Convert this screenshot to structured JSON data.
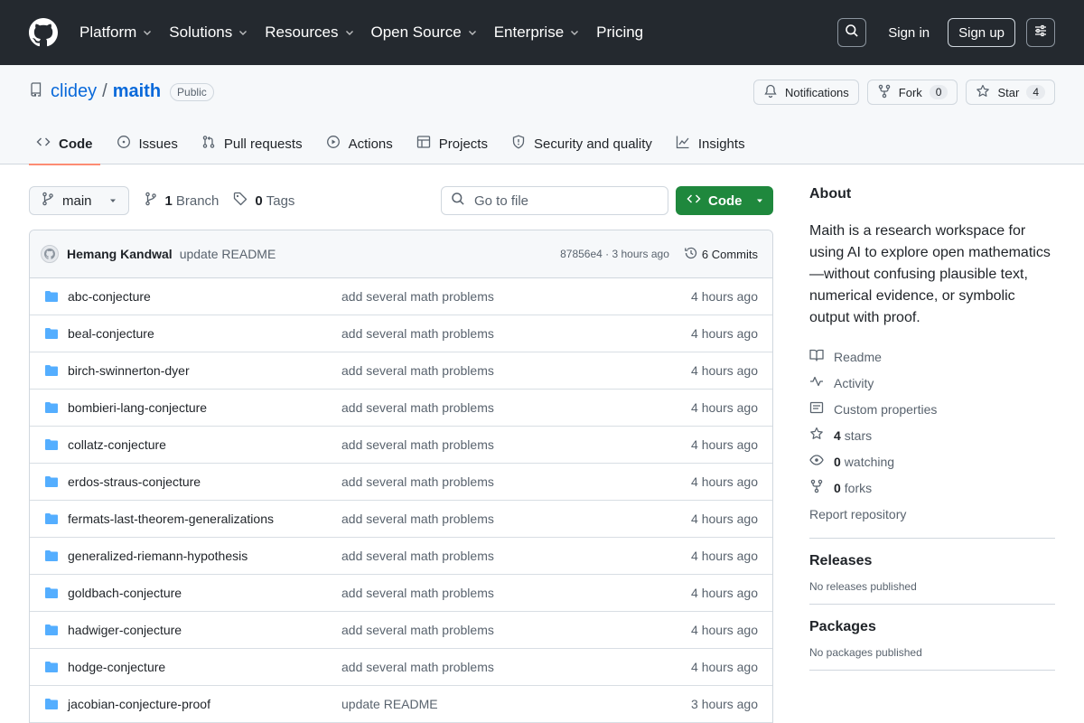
{
  "header": {
    "nav": [
      {
        "label": "Platform",
        "dropdown": true
      },
      {
        "label": "Solutions",
        "dropdown": true
      },
      {
        "label": "Resources",
        "dropdown": true
      },
      {
        "label": "Open Source",
        "dropdown": true
      },
      {
        "label": "Enterprise",
        "dropdown": true
      },
      {
        "label": "Pricing",
        "dropdown": false
      }
    ],
    "signin": "Sign in",
    "signup": "Sign up"
  },
  "repo": {
    "owner": "clidey",
    "slash": "/",
    "name": "maith",
    "visibility": "Public",
    "actions": {
      "notifications": "Notifications",
      "fork": "Fork",
      "fork_count": "0",
      "star": "Star",
      "star_count": "4"
    },
    "tabs": [
      {
        "label": "Code",
        "icon": "code-icon"
      },
      {
        "label": "Issues",
        "icon": "issue-icon"
      },
      {
        "label": "Pull requests",
        "icon": "pull-request-icon"
      },
      {
        "label": "Actions",
        "icon": "play-icon"
      },
      {
        "label": "Projects",
        "icon": "table-icon"
      },
      {
        "label": "Security and quality",
        "icon": "shield-icon"
      },
      {
        "label": "Insights",
        "icon": "graph-icon"
      }
    ]
  },
  "controls": {
    "branch": "main",
    "branch_count": "1",
    "branch_label": "Branch",
    "tag_count": "0",
    "tag_label": "Tags",
    "goto_placeholder": "Go to file",
    "code_button": "Code"
  },
  "commit": {
    "author": "Hemang Kandwal",
    "message": "update README",
    "hash_age": "87856e4 · 3 hours ago",
    "count": "6 Commits"
  },
  "files": [
    {
      "name": "abc-conjecture",
      "message": "add several math problems",
      "age": "4 hours ago"
    },
    {
      "name": "beal-conjecture",
      "message": "add several math problems",
      "age": "4 hours ago"
    },
    {
      "name": "birch-swinnerton-dyer",
      "message": "add several math problems",
      "age": "4 hours ago"
    },
    {
      "name": "bombieri-lang-conjecture",
      "message": "add several math problems",
      "age": "4 hours ago"
    },
    {
      "name": "collatz-conjecture",
      "message": "add several math problems",
      "age": "4 hours ago"
    },
    {
      "name": "erdos-straus-conjecture",
      "message": "add several math problems",
      "age": "4 hours ago"
    },
    {
      "name": "fermats-last-theorem-generalizations",
      "message": "add several math problems",
      "age": "4 hours ago"
    },
    {
      "name": "generalized-riemann-hypothesis",
      "message": "add several math problems",
      "age": "4 hours ago"
    },
    {
      "name": "goldbach-conjecture",
      "message": "add several math problems",
      "age": "4 hours ago"
    },
    {
      "name": "hadwiger-conjecture",
      "message": "add several math problems",
      "age": "4 hours ago"
    },
    {
      "name": "hodge-conjecture",
      "message": "add several math problems",
      "age": "4 hours ago"
    },
    {
      "name": "jacobian-conjecture-proof",
      "message": "update README",
      "age": "3 hours ago"
    }
  ],
  "sidebar": {
    "about_title": "About",
    "about_text": "Maith is a research workspace for using AI to explore open mathematics—without confusing plausible text, numerical evidence, or symbolic output with proof.",
    "links": {
      "readme": "Readme",
      "activity": "Activity",
      "custom": "Custom properties",
      "stars_count": "4",
      "stars_label": "stars",
      "watching_count": "0",
      "watching_label": "watching",
      "forks_count": "0",
      "forks_label": "forks",
      "report": "Report repository"
    },
    "releases_title": "Releases",
    "releases_text": "No releases published",
    "packages_title": "Packages",
    "packages_text": "No packages published"
  },
  "colors": {
    "header_bg": "#24292f",
    "accent_blue": "#0969da",
    "code_green": "#1f883d",
    "folder_blue": "#54aeff",
    "tab_underline": "#fd8c73"
  }
}
